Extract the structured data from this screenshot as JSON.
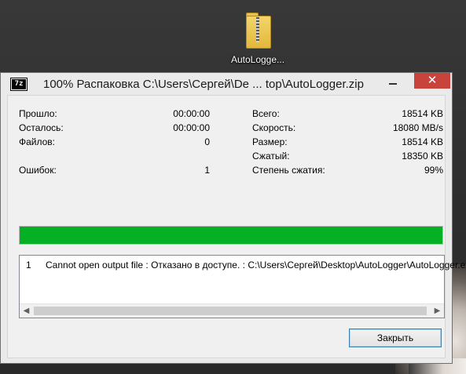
{
  "desktop": {
    "icon_label": "AutoLogge..."
  },
  "window": {
    "app_icon_text": "7z",
    "title": "100% Распаковка C:\\Users\\Сергей\\De ... top\\AutoLogger.zip",
    "close_symbol": "✕"
  },
  "stats": {
    "left": [
      {
        "label": "Прошло:",
        "value": "00:00:00"
      },
      {
        "label": "Осталось:",
        "value": "00:00:00"
      },
      {
        "label": "Файлов:",
        "value": "0"
      },
      {
        "label": "Ошибок:",
        "value": "1"
      }
    ],
    "right": [
      {
        "label": "Всего:",
        "value": "18514 KB"
      },
      {
        "label": "Скорость:",
        "value": "18080 MB/s"
      },
      {
        "label": "Размер:",
        "value": "18514 KB"
      },
      {
        "label": "Сжатый:",
        "value": "18350 KB"
      },
      {
        "label": "Степень сжатия:",
        "value": "99%"
      }
    ]
  },
  "progress": {
    "fraction": 1.0,
    "color": "#06b025"
  },
  "log": {
    "rows": [
      {
        "num": "1",
        "text": "Cannot open output file : Отказано в доступе. : C:\\Users\\Сергей\\Desktop\\AutoLogger\\AutoLogger.exe"
      }
    ]
  },
  "buttons": {
    "extract_label": "Закрыть"
  },
  "icons": {
    "desktop_icon": "zip-folder-icon",
    "app_icon": "7zip-icon",
    "minimize": "minimize-icon",
    "close": "close-icon",
    "scroll_left": "scroll-left-arrow-icon",
    "scroll_right": "scroll-right-arrow-icon"
  }
}
